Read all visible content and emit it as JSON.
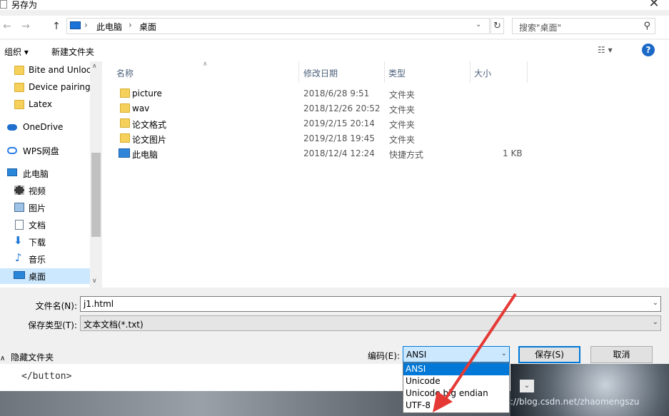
{
  "window": {
    "title": "另存为"
  },
  "nav": {
    "back": "←",
    "forward": "→",
    "up": "↑",
    "breadcrumbs": [
      "此电脑",
      "桌面"
    ],
    "refresh": "↻",
    "search_placeholder": "搜索\"桌面\""
  },
  "toolbar": {
    "organize": "组织 ▾",
    "new_folder": "新建文件夹",
    "view": "☷ ▾",
    "help": "?"
  },
  "sidebar": {
    "items": [
      {
        "label": "Bite and Unloc",
        "icon": "folder-icon"
      },
      {
        "label": "Device pairing",
        "icon": "folder-icon"
      },
      {
        "label": "Latex",
        "icon": "folder-icon"
      },
      {
        "label": "OneDrive",
        "icon": "cloud-icon"
      },
      {
        "label": "WPS网盘",
        "icon": "cloud-icon"
      },
      {
        "label": "此电脑",
        "icon": "computer-icon"
      },
      {
        "label": "视频",
        "icon": "video-icon"
      },
      {
        "label": "图片",
        "icon": "picture-icon"
      },
      {
        "label": "文档",
        "icon": "document-icon"
      },
      {
        "label": "下载",
        "icon": "download-icon"
      },
      {
        "label": "音乐",
        "icon": "music-icon"
      },
      {
        "label": "桌面",
        "icon": "desktop-icon"
      }
    ]
  },
  "files": {
    "columns": [
      "名称",
      "修改日期",
      "类型",
      "大小"
    ],
    "rows": [
      {
        "name": "picture",
        "date": "2018/6/28 9:51",
        "type": "文件夹",
        "size": ""
      },
      {
        "name": "wav",
        "date": "2018/12/26 20:52",
        "type": "文件夹",
        "size": ""
      },
      {
        "name": "论文格式",
        "date": "2019/2/15 20:14",
        "type": "文件夹",
        "size": ""
      },
      {
        "name": "论文图片",
        "date": "2019/2/18 19:45",
        "type": "文件夹",
        "size": ""
      },
      {
        "name": "此电脑",
        "date": "2018/12/4 12:24",
        "type": "快捷方式",
        "size": "1 KB"
      }
    ]
  },
  "form": {
    "filename_label": "文件名(N):",
    "filename_value": "j1.html",
    "filetype_label": "保存类型(T):",
    "filetype_value": "文本文档(*.txt)",
    "hide_folders": "隐藏文件夹",
    "encoding_label": "编码(E):",
    "encoding_value": "ANSI",
    "encoding_options": [
      "ANSI",
      "Unicode",
      "Unicode big endian",
      "UTF-8"
    ],
    "save_button": "保存(S)",
    "cancel_button": "取消"
  },
  "background": {
    "code_text": "</button>",
    "watermark": "https://blog.csdn.net/zhaomengszu"
  },
  "colors": {
    "accent": "#0078d7",
    "selection": "#cce8ff",
    "arrow": "#e53935"
  }
}
